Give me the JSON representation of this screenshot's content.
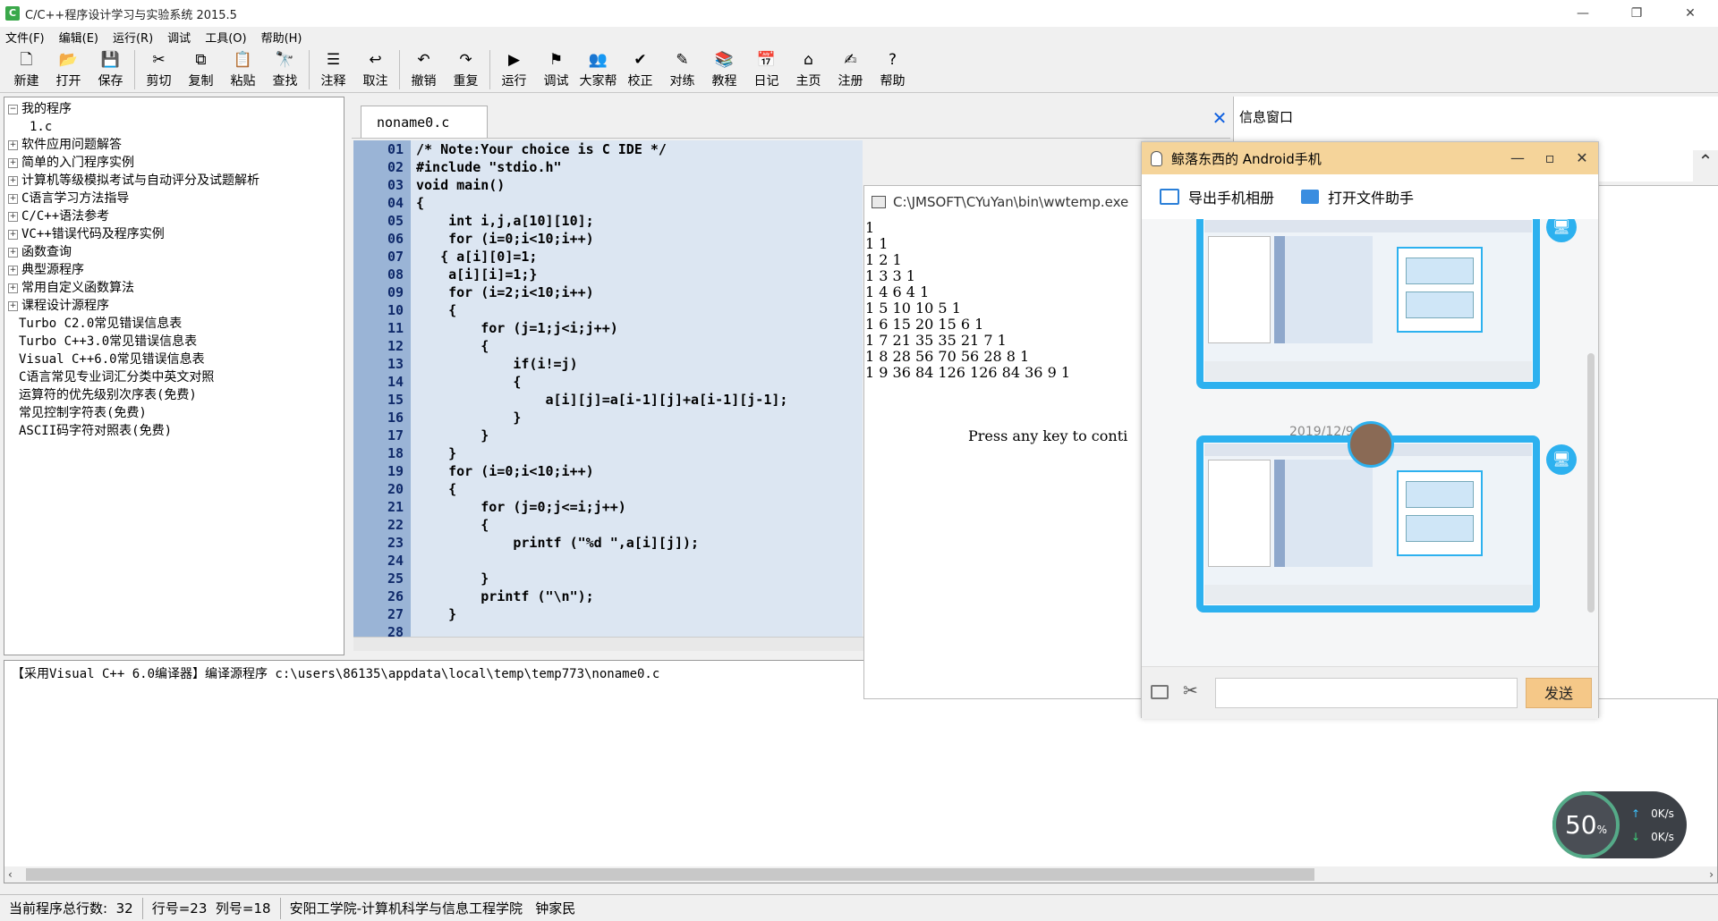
{
  "window": {
    "title": "C/C++程序设计学习与实验系统 2015.5",
    "icon_label": "C",
    "min": "—",
    "max": "❐",
    "close": "✕"
  },
  "menu": [
    "文件(F)",
    "编辑(E)",
    "运行(R)",
    "调试",
    "工具(O)",
    "帮助(H)"
  ],
  "toolbar": [
    {
      "label": "新建",
      "icon": "new-file-icon",
      "glyph": "🗋"
    },
    {
      "label": "打开",
      "icon": "open-folder-icon",
      "glyph": "📂"
    },
    {
      "label": "保存",
      "icon": "save-icon",
      "glyph": "💾"
    },
    {
      "label": "剪切",
      "icon": "cut-icon",
      "glyph": "✂"
    },
    {
      "label": "复制",
      "icon": "copy-icon",
      "glyph": "⧉"
    },
    {
      "label": "粘贴",
      "icon": "paste-icon",
      "glyph": "📋"
    },
    {
      "label": "查找",
      "icon": "find-icon",
      "glyph": "🔭"
    },
    {
      "label": "注释",
      "icon": "comment-icon",
      "glyph": "☰"
    },
    {
      "label": "取注",
      "icon": "uncomment-icon",
      "glyph": "↩"
    },
    {
      "label": "撤销",
      "icon": "undo-icon",
      "glyph": "↶"
    },
    {
      "label": "重复",
      "icon": "redo-icon",
      "glyph": "↷"
    },
    {
      "label": "运行",
      "icon": "run-icon",
      "glyph": "▶"
    },
    {
      "label": "调试",
      "icon": "debug-icon",
      "glyph": "⚑"
    },
    {
      "label": "大家帮",
      "icon": "community-icon",
      "glyph": "👥"
    },
    {
      "label": "校正",
      "icon": "check-icon",
      "glyph": "✔"
    },
    {
      "label": "对练",
      "icon": "practice-icon",
      "glyph": "✎"
    },
    {
      "label": "教程",
      "icon": "tutorial-icon",
      "glyph": "📚"
    },
    {
      "label": "日记",
      "icon": "diary-icon",
      "glyph": "📅"
    },
    {
      "label": "主页",
      "icon": "home-icon",
      "glyph": "⌂"
    },
    {
      "label": "注册",
      "icon": "register-icon",
      "glyph": "✍"
    },
    {
      "label": "帮助",
      "icon": "help-icon",
      "glyph": "?"
    }
  ],
  "tree": [
    {
      "label": "我的程序",
      "exp": "⊟",
      "indent": 0
    },
    {
      "label": "1.c",
      "exp": "",
      "indent": 2
    },
    {
      "label": "软件应用问题解答",
      "exp": "⊞",
      "indent": 0
    },
    {
      "label": "简单的入门程序实例",
      "exp": "⊞",
      "indent": 0
    },
    {
      "label": "计算机等级模拟考试与自动评分及试题解析",
      "exp": "⊞",
      "indent": 0
    },
    {
      "label": "C语言学习方法指导",
      "exp": "⊞",
      "indent": 0
    },
    {
      "label": "C/C++语法参考",
      "exp": "⊞",
      "indent": 0
    },
    {
      "label": "VC++错误代码及程序实例",
      "exp": "⊞",
      "indent": 0
    },
    {
      "label": "函数查询",
      "exp": "⊞",
      "indent": 0
    },
    {
      "label": "典型源程序",
      "exp": "⊞",
      "indent": 0
    },
    {
      "label": "常用自定义函数算法",
      "exp": "⊞",
      "indent": 0
    },
    {
      "label": "课程设计源程序",
      "exp": "⊞",
      "indent": 0
    },
    {
      "label": "Turbo C2.0常见错误信息表",
      "exp": "",
      "indent": 1
    },
    {
      "label": "Turbo C++3.0常见错误信息表",
      "exp": "",
      "indent": 1
    },
    {
      "label": "Visual C++6.0常见错误信息表",
      "exp": "",
      "indent": 1
    },
    {
      "label": "C语言常见专业词汇分类中英文对照",
      "exp": "",
      "indent": 1
    },
    {
      "label": "运算符的优先级别次序表(免费)",
      "exp": "",
      "indent": 1
    },
    {
      "label": "常见控制字符表(免费)",
      "exp": "",
      "indent": 1
    },
    {
      "label": "ASCII码字符对照表(免费)",
      "exp": "",
      "indent": 1
    }
  ],
  "editor": {
    "tab": "noname0.c",
    "close": "✕",
    "line_numbers": [
      "01",
      "02",
      "03",
      "04",
      "05",
      "06",
      "07",
      "08",
      "09",
      "10",
      "11",
      "12",
      "13",
      "14",
      "15",
      "16",
      "17",
      "18",
      "19",
      "20",
      "21",
      "22",
      "23",
      "24",
      "25",
      "26",
      "27",
      "28"
    ],
    "code": [
      "/* Note:Your choice is C IDE */",
      "#include \"stdio.h\"",
      "void main()",
      "{",
      "    int i,j,a[10][10];",
      "    for (i=0;i<10;i++)",
      "   { a[i][0]=1;",
      "    a[i][i]=1;}",
      "    for (i=2;i<10;i++)",
      "    {",
      "        for (j=1;j<i;j++)",
      "        {",
      "            if(i!=j)",
      "            {",
      "                a[i][j]=a[i-1][j]+a[i-1][j-1];",
      "            }",
      "        }",
      "    }",
      "    for (i=0;i<10;i++)",
      "    {",
      "        for (j=0;j<=i;j++)",
      "        {",
      "            printf (\"%d \",a[i][j]);",
      "",
      "        }",
      "        printf (\"\\n\");",
      "    }",
      ""
    ]
  },
  "info": {
    "title": "信息窗口",
    "scroll_up": "⌃"
  },
  "output": {
    "text": "【采用Visual C++ 6.0编译器】编译源程序 c:\\users\\86135\\appdata\\local\\temp\\temp773\\noname0.c",
    "left": "‹",
    "right": "›"
  },
  "status": {
    "total_label": "当前程序总行数:",
    "total": "32",
    "row": "行号=23",
    "col": "列号=18",
    "school": "安阳工学院-计算机科学与信息工程学院",
    "author": "钟家民"
  },
  "console": {
    "title": "C:\\JMSOFT\\CYuYan\\bin\\wwtemp.exe",
    "lines": [
      "1",
      "1 1",
      "1 2 1",
      "1 3 3 1",
      "1 4 6 4 1",
      "1 5 10 10 5 1",
      "1 6 15 20 15 6 1",
      "1 7 21 35 35 21 7 1",
      "1 8 28 56 70 56 28 8 1",
      "1 9 36 84 126 126 84 36 9 1"
    ],
    "press": "Press any key to conti"
  },
  "qq": {
    "title": "鲸落东西的 Android手机",
    "min": "—",
    "max": "▫",
    "close": "✕",
    "action1": "导出手机相册",
    "action2": "打开文件助手",
    "date": "2019/12/9",
    "send": "发送",
    "scissor": "✂",
    "device_glyph": "🖥"
  },
  "net": {
    "percent": "50",
    "unit": "%",
    "up": "0K/s",
    "down": "0K/s",
    "up_arrow": "↑",
    "down_arrow": "↓"
  },
  "colors": {
    "code_bg": "#dce6f2",
    "gutter": "#9ab4d6",
    "keyword": "#0000d0",
    "qq_title": "#f5d49a",
    "qq_accent": "#2db1ef"
  }
}
